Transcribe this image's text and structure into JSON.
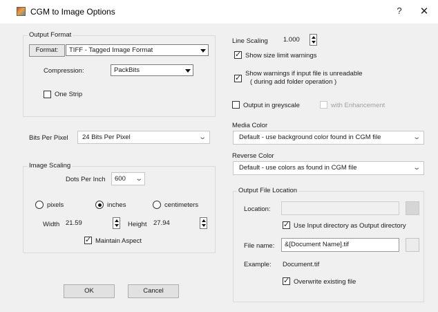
{
  "window": {
    "title": "CGM to Image Options",
    "help_label": "?",
    "close_label": "✕"
  },
  "output_format": {
    "group_label": "Output Format",
    "format_button_label": "Format:",
    "format_value": "TIFF - Tagged Image Format",
    "compression_label": "Compression:",
    "compression_value": "PackBits",
    "one_strip_label": "One Strip",
    "one_strip_checked": false
  },
  "bits_per_pixel": {
    "label": "Bits Per Pixel",
    "value": "24 Bits Per Pixel"
  },
  "image_scaling": {
    "group_label": "Image Scaling",
    "dpi_label": "Dots Per Inch",
    "dpi_value": "600",
    "units": [
      {
        "label": "pixels",
        "selected": false
      },
      {
        "label": "inches",
        "selected": true
      },
      {
        "label": "centimeters",
        "selected": false
      }
    ],
    "width_label": "Width",
    "width_value": "21.59",
    "height_label": "Height",
    "height_value": "27.94",
    "maintain_aspect_label": "Maintain Aspect",
    "maintain_aspect_checked": true
  },
  "buttons": {
    "ok_label": "OK",
    "cancel_label": "Cancel"
  },
  "line_scaling": {
    "label": "Line Scaling",
    "value": "1.000"
  },
  "warnings": {
    "size_limit_label": "Show size limit warnings",
    "size_limit_checked": true,
    "unreadable_line1": "Show warnings if input file is unreadable",
    "unreadable_line2": "( during add folder operation )",
    "unreadable_checked": true
  },
  "greyscale": {
    "label": "Output in greyscale",
    "checked": false,
    "enhancement_label": "with Enhancement",
    "enhancement_checked": false
  },
  "media_color": {
    "label": "Media Color",
    "value": "Default - use background color found in CGM file"
  },
  "reverse_color": {
    "label": "Reverse Color",
    "value": "Default - use colors as found in CGM file"
  },
  "output_location": {
    "group_label": "Output File Location",
    "location_label": "Location:",
    "location_value": "",
    "use_input_dir_label": "Use Input directory as Output directory",
    "use_input_dir_checked": true,
    "file_name_label": "File name:",
    "file_name_value": "&[Document Name].tif",
    "example_label": "Example:",
    "example_value": "Document.tif",
    "overwrite_label": "Overwrite existing file",
    "overwrite_checked": true
  }
}
